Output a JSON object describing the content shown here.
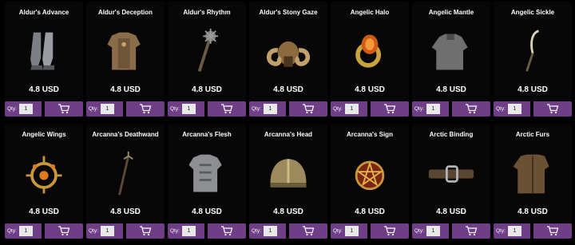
{
  "store": {
    "qty_label": "Qty:",
    "accent_color": "#6e3f86",
    "items": [
      {
        "name": "Aldur's Advance",
        "price": "4.8 USD",
        "qty": "1",
        "icon": "greaves-icon"
      },
      {
        "name": "Aldur's Deception",
        "price": "4.8 USD",
        "qty": "1",
        "icon": "armor-icon"
      },
      {
        "name": "Aldur's Rhythm",
        "price": "4.8 USD",
        "qty": "1",
        "icon": "mace-icon"
      },
      {
        "name": "Aldur's Stony Gaze",
        "price": "4.8 USD",
        "qty": "1",
        "icon": "ram-helm-icon"
      },
      {
        "name": "Angelic Halo",
        "price": "4.8 USD",
        "qty": "1",
        "icon": "ring-icon"
      },
      {
        "name": "Angelic Mantle",
        "price": "4.8 USD",
        "qty": "1",
        "icon": "mantle-icon"
      },
      {
        "name": "Angelic Sickle",
        "price": "4.8 USD",
        "qty": "1",
        "icon": "sickle-icon"
      },
      {
        "name": "Angelic Wings",
        "price": "4.8 USD",
        "qty": "1",
        "icon": "amulet-icon"
      },
      {
        "name": "Arcanna's Deathwand",
        "price": "4.8 USD",
        "qty": "1",
        "icon": "staff-icon"
      },
      {
        "name": "Arcanna's Flesh",
        "price": "4.8 USD",
        "qty": "1",
        "icon": "plate-armor-icon"
      },
      {
        "name": "Arcanna's Head",
        "price": "4.8 USD",
        "qty": "1",
        "icon": "cap-icon"
      },
      {
        "name": "Arcanna's Sign",
        "price": "4.8 USD",
        "qty": "1",
        "icon": "pentagram-amulet-icon"
      },
      {
        "name": "Arctic Binding",
        "price": "4.8 USD",
        "qty": "1",
        "icon": "belt-icon"
      },
      {
        "name": "Arctic Furs",
        "price": "4.8 USD",
        "qty": "1",
        "icon": "coat-icon"
      }
    ]
  }
}
